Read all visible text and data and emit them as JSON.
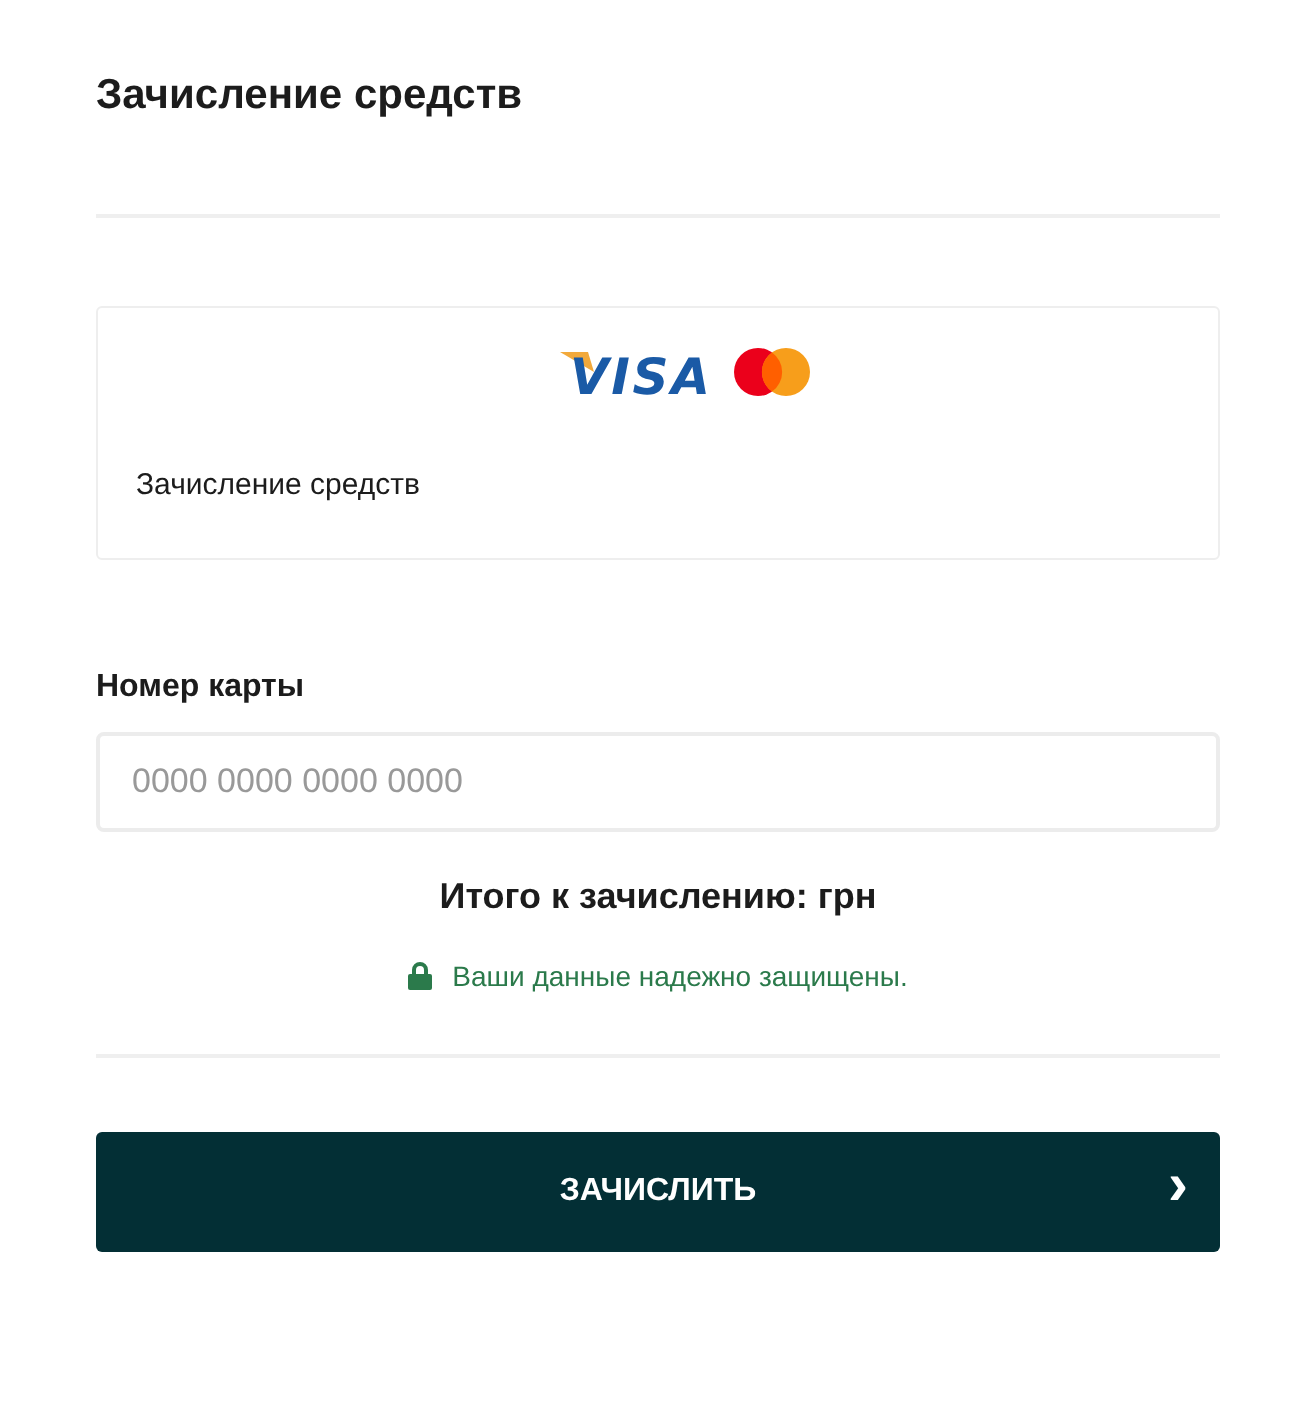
{
  "title": "Зачисление средств",
  "payment_method": {
    "logo_text": "VISA",
    "label": "Зачисление средств"
  },
  "card_field": {
    "label": "Номер карты",
    "placeholder": "0000 0000 0000 0000"
  },
  "total": "Итого к зачислению: грн",
  "security_note": "Ваши данные надежно защищены.",
  "submit_button": {
    "label": "ЗАЧИСЛИТЬ",
    "arrow": "›"
  }
}
